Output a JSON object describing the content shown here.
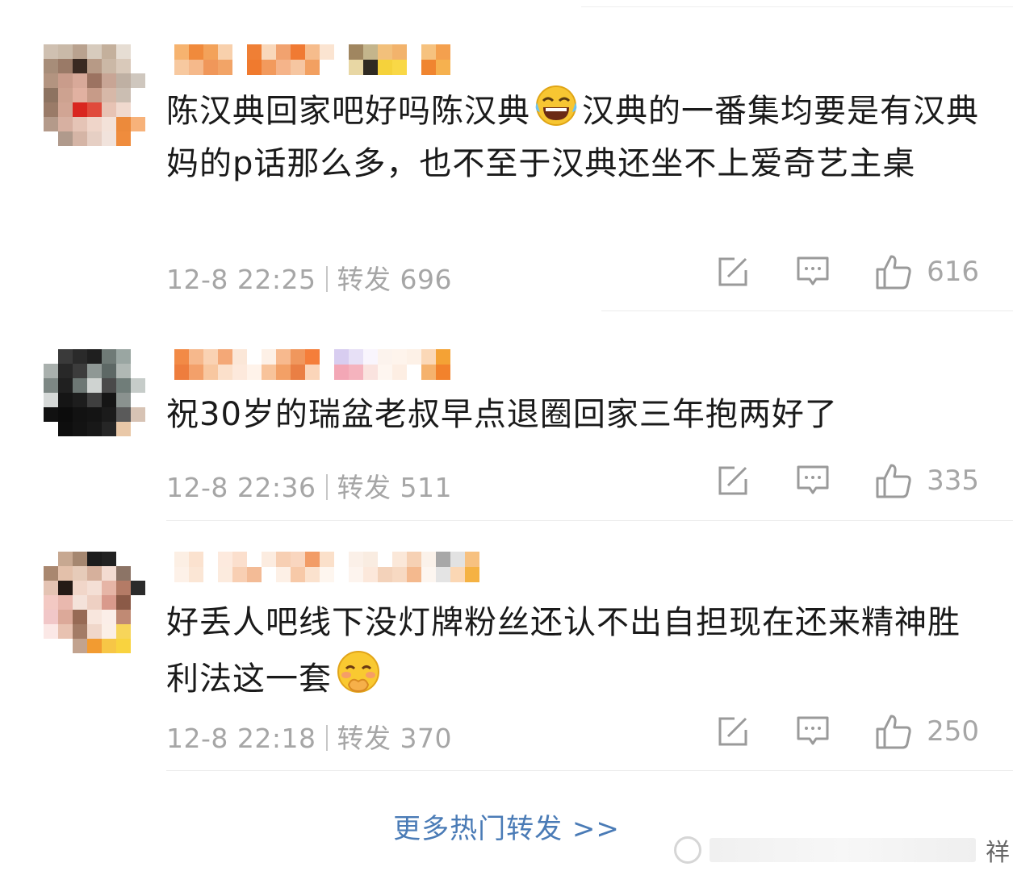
{
  "comments": [
    {
      "text": "陈汉典回家吧好吗陈汉典",
      "emoji": "laughing-tears-emoji",
      "text_after_emoji": "汉典的一番集均要是有汉典妈的p话那么多，也不至于汉典还坐不上爱奇艺主桌",
      "time": "12-8 22:25",
      "repost_label": "转发",
      "repost_count": "696",
      "like_count": "616"
    },
    {
      "text": "祝30岁的瑞盆老叔早点退圈回家三年抱两好了",
      "time": "12-8 22:36",
      "repost_label": "转发",
      "repost_count": "511",
      "like_count": "335"
    },
    {
      "text": "好丢人吧线下没灯牌粉丝还认不出自担现在还来精神胜利法这一套",
      "emoji": "pleading-emoji",
      "time": "12-8 22:18",
      "repost_label": "转发",
      "repost_count": "370",
      "like_count": "250"
    }
  ],
  "footer": {
    "more_link": "更多热门转发 >>",
    "watermark_char": "祥"
  },
  "icons": [
    "share-icon",
    "comment-icon",
    "like-icon"
  ]
}
